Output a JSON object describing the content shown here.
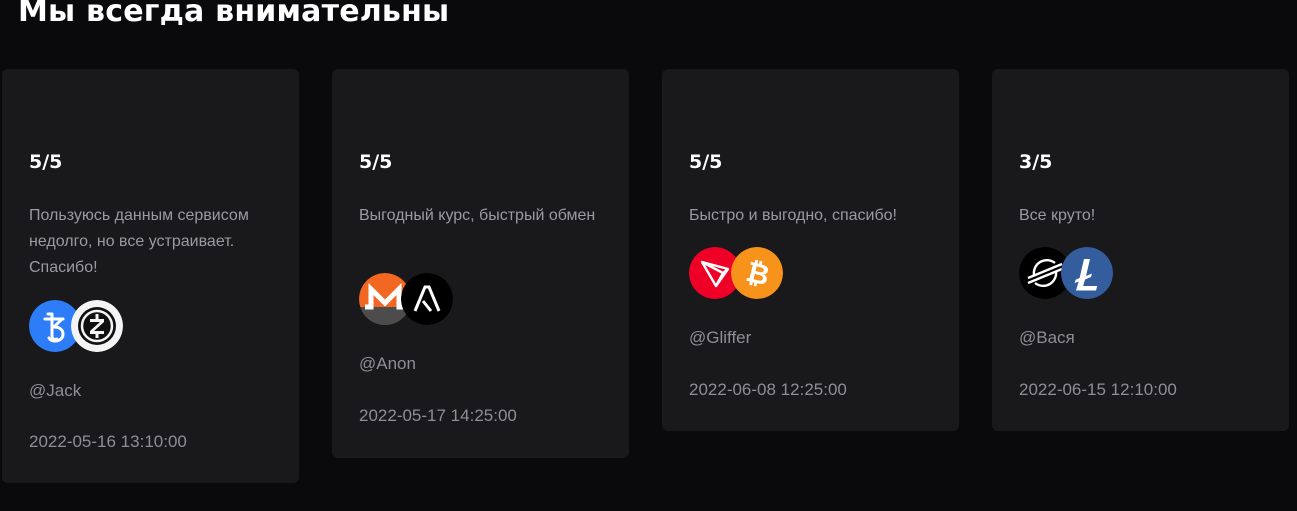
{
  "section": {
    "title": "Мы всегда внимательны"
  },
  "reviews": [
    {
      "rating": "5/5",
      "text": "Пользуюсь данным сервисом недолго, но все устраивает. Спасибо!",
      "coins": [
        "tezos-icon",
        "zcash-icon"
      ],
      "user": "@Jack",
      "date": "2022-05-16 13:10:00"
    },
    {
      "rating": "5/5",
      "text": "Выгодный курс, быстрый обмен",
      "coins": [
        "monero-icon",
        "algorand-icon"
      ],
      "user": "@Anon",
      "date": "2022-05-17 14:25:00"
    },
    {
      "rating": "5/5",
      "text": "Быстро и выгодно, спасибо!",
      "coins": [
        "tron-icon",
        "bitcoin-icon"
      ],
      "user": "@Gliffer",
      "date": "2022-06-08 12:25:00"
    },
    {
      "rating": "3/5",
      "text": "Все круто!",
      "coins": [
        "stellar-icon",
        "litecoin-icon"
      ],
      "user": "@Вася",
      "date": "2022-06-15 12:10:00"
    }
  ],
  "colors": {
    "background": "#0a0a0c",
    "card": "#19191c",
    "tezos": "#2c7df7",
    "zcash": "#ffffff",
    "monero": "#f26822",
    "algorand": "#000000",
    "tron": "#ef0027",
    "bitcoin": "#f7931a",
    "stellar": "#000000",
    "litecoin": "#345d9d"
  }
}
